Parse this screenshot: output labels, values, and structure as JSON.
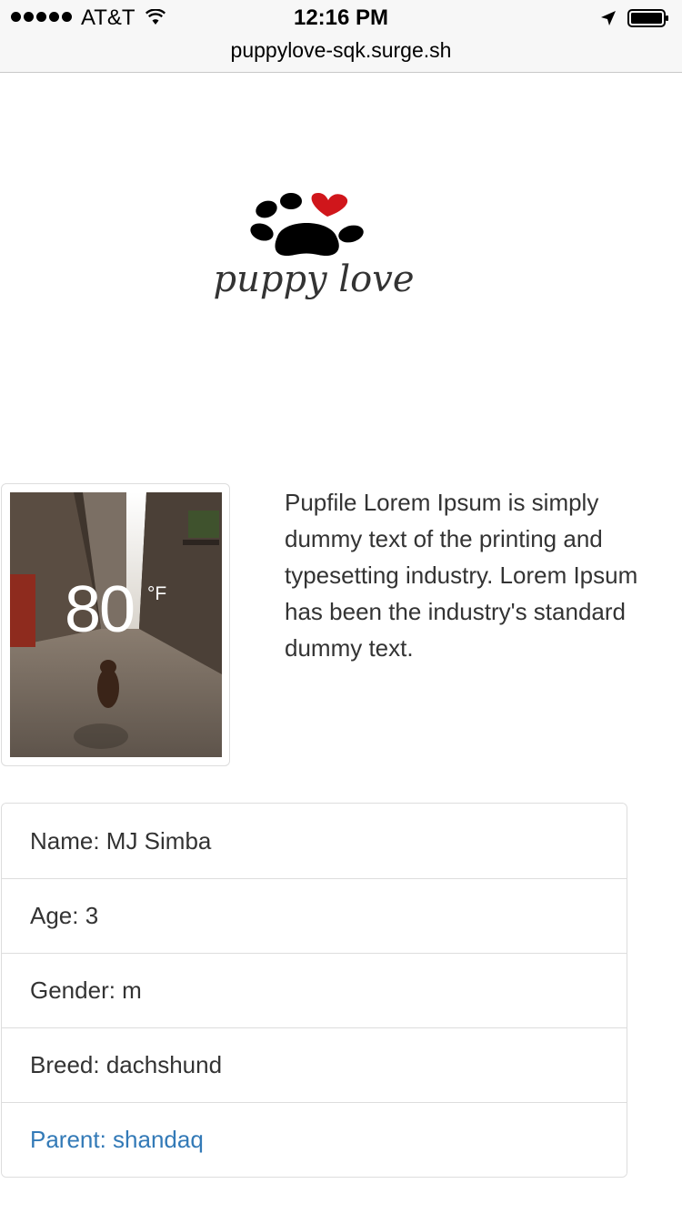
{
  "status_bar": {
    "carrier": "AT&T",
    "time": "12:16 PM",
    "url": "puppylove-sqk.surge.sh",
    "icons": [
      "signal-dots-icon",
      "wifi-icon",
      "location-arrow-icon",
      "battery-icon"
    ]
  },
  "logo": {
    "text": "puppy love",
    "icon": "paw-heart-logo",
    "colors": {
      "paw": "#000000",
      "heart": "#d0161b",
      "text": "#333333"
    }
  },
  "profile": {
    "weather_overlay": {
      "temperature": "80",
      "unit": "°F"
    },
    "description": "Pupfile Lorem Ipsum is simply dummy text of the printing and typesetting industry. Lorem Ipsum has been the industry's standard dummy text."
  },
  "details": {
    "name": "Name: MJ Simba",
    "age": "Age: 3",
    "gender": "Gender: m",
    "breed": "Breed: dachshund",
    "parent": "Parent: shandaq"
  },
  "colors": {
    "link": "#337ab7",
    "text": "#333333",
    "border": "#dddddd"
  }
}
